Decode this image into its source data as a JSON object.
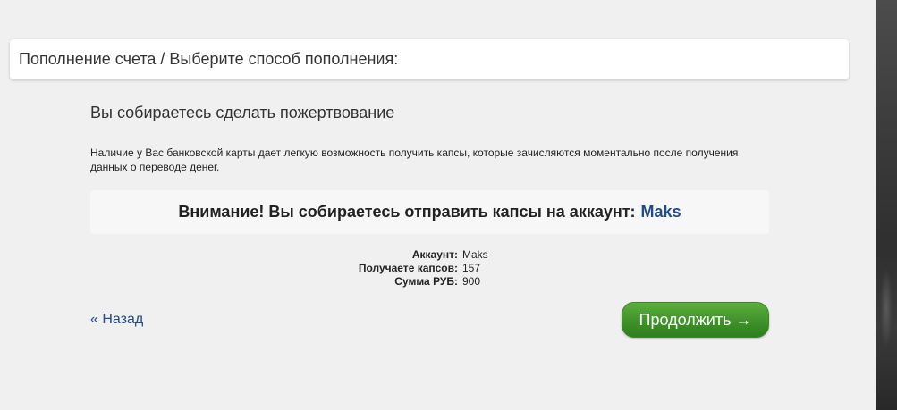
{
  "header": {
    "title": "Пополнение счета / Выберите способ пополнения:"
  },
  "main": {
    "heading": "Вы собираетесь сделать пожертвование",
    "description": "Наличие у Вас банковской карты дает легкую возможность получить капсы, которые зачисляются моментально после получения данных о переводе денег.",
    "warning": {
      "text": "Внимание! Вы собираетесь отправить капсы на аккаунт:",
      "account": "Maks"
    },
    "details": [
      {
        "label": "Аккаунт:",
        "value": "Maks"
      },
      {
        "label": "Получаете капсов:",
        "value": "157"
      },
      {
        "label": "Сумма РУБ:",
        "value": "900"
      }
    ],
    "back_label": "« Назад",
    "continue_label": "Продолжить →"
  },
  "colors": {
    "link": "#214b8a",
    "button_green": "#3f922a",
    "background": "#f0f0f0"
  }
}
